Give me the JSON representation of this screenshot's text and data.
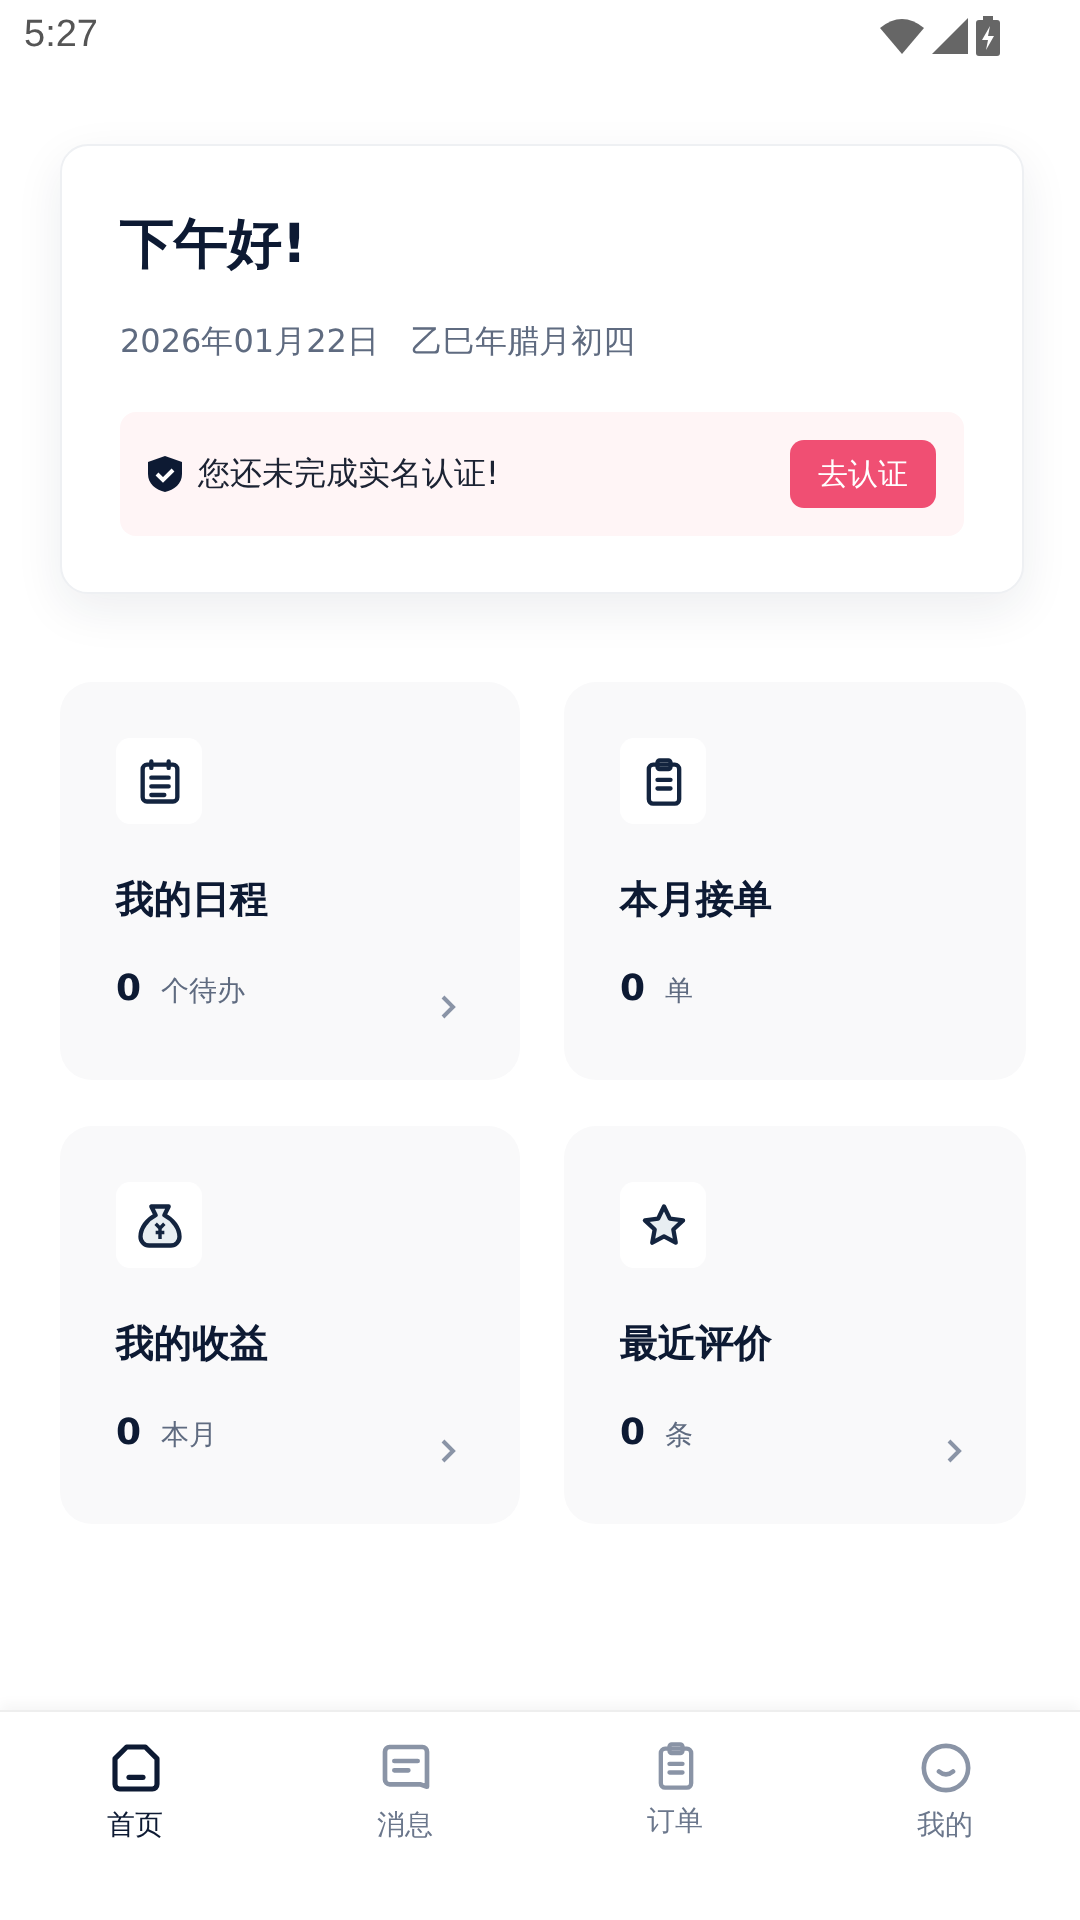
{
  "status_bar": {
    "time": "5:27"
  },
  "greeting": {
    "title": "下午好!",
    "date": "2026年01月22日",
    "lunar_date": "乙巳年腊月初四",
    "notice": {
      "text": "您还未完成实名认证!",
      "button": "去认证"
    }
  },
  "cards": [
    {
      "kind": "calendar",
      "title": "我的日程",
      "count": "0",
      "unit": "个待办",
      "has_arrow": true
    },
    {
      "kind": "clipboard",
      "title": "本月接单",
      "count": "0",
      "unit": "单",
      "has_arrow": false
    },
    {
      "kind": "moneybag",
      "title": "我的收益",
      "count": "0",
      "unit": "本月",
      "has_arrow": true
    },
    {
      "kind": "star",
      "title": "最近评价",
      "count": "0",
      "unit": "条",
      "has_arrow": true
    }
  ],
  "bottom_nav": [
    {
      "kind": "home",
      "label": "首页",
      "selected": true
    },
    {
      "kind": "message",
      "label": "消息",
      "selected": false
    },
    {
      "kind": "clipboard",
      "label": "订单",
      "selected": false
    },
    {
      "kind": "face",
      "label": "我的",
      "selected": false
    }
  ]
}
